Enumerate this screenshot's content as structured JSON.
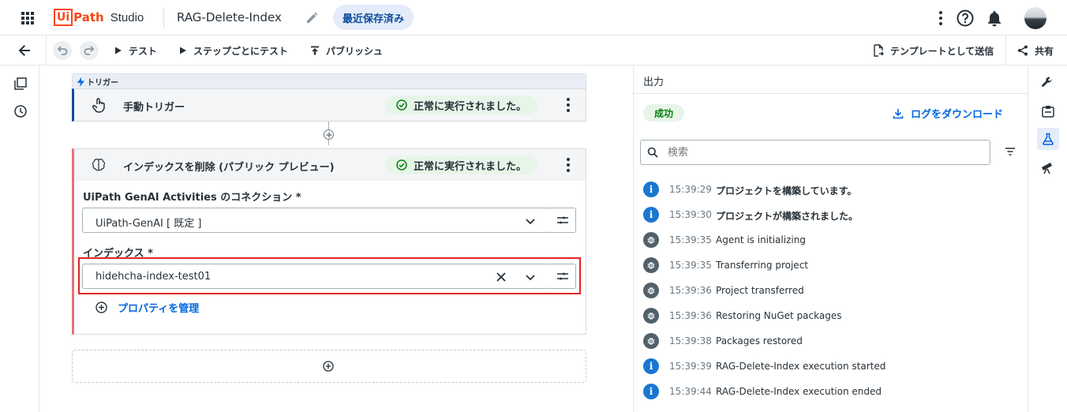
{
  "header": {
    "logo_ui": "Ui",
    "logo_path": "Path",
    "product": "Studio",
    "project_name": "RAG-Delete-Index",
    "save_status": "最近保存済み"
  },
  "toolbar": {
    "test_label": "テスト",
    "step_test_label": "ステップごとにテスト",
    "publish_label": "パブリッシュ",
    "send_template_label": "テンプレートとして送信",
    "share_label": "共有"
  },
  "trigger_section": {
    "tag_label": "トリガー",
    "title": "手動トリガー",
    "status": "正常に実行されました。"
  },
  "activity": {
    "title": "インデックスを削除 (パブリック プレビュー)",
    "status": "正常に実行されました。",
    "connection_label": "UiPath GenAI Activities のコネクション *",
    "connection_value": "UiPath-GenAI [ 既定 ]",
    "index_label": "インデックス *",
    "index_value": "hidehcha-index-test01",
    "manage_props_label": "プロパティを管理"
  },
  "output": {
    "title": "出力",
    "status_badge": "成功",
    "download_label": "ログをダウンロード",
    "search_placeholder": "検索",
    "logs": [
      {
        "type": "info",
        "time": "15:39:29",
        "message": "プロジェクトを構築しています。"
      },
      {
        "type": "info",
        "time": "15:39:30",
        "message": "プロジェクトが構築されました。"
      },
      {
        "type": "debug",
        "time": "15:39:35",
        "message": "Agent is initializing"
      },
      {
        "type": "debug",
        "time": "15:39:35",
        "message": "Transferring project"
      },
      {
        "type": "debug",
        "time": "15:39:36",
        "message": "Project transferred"
      },
      {
        "type": "debug",
        "time": "15:39:36",
        "message": "Restoring NuGet packages"
      },
      {
        "type": "debug",
        "time": "15:39:38",
        "message": "Packages restored"
      },
      {
        "type": "info",
        "time": "15:39:39",
        "message": "RAG-Delete-Index execution started"
      },
      {
        "type": "info",
        "time": "15:39:44",
        "message": "RAG-Delete-Index execution ended"
      }
    ]
  },
  "colors": {
    "accent_blue": "#0067df",
    "brand_red": "#fa4616",
    "success_green": "#e7f5e9",
    "info_blue": "#1976d2",
    "debug_gray": "#526069",
    "highlight_red": "#e02424"
  }
}
